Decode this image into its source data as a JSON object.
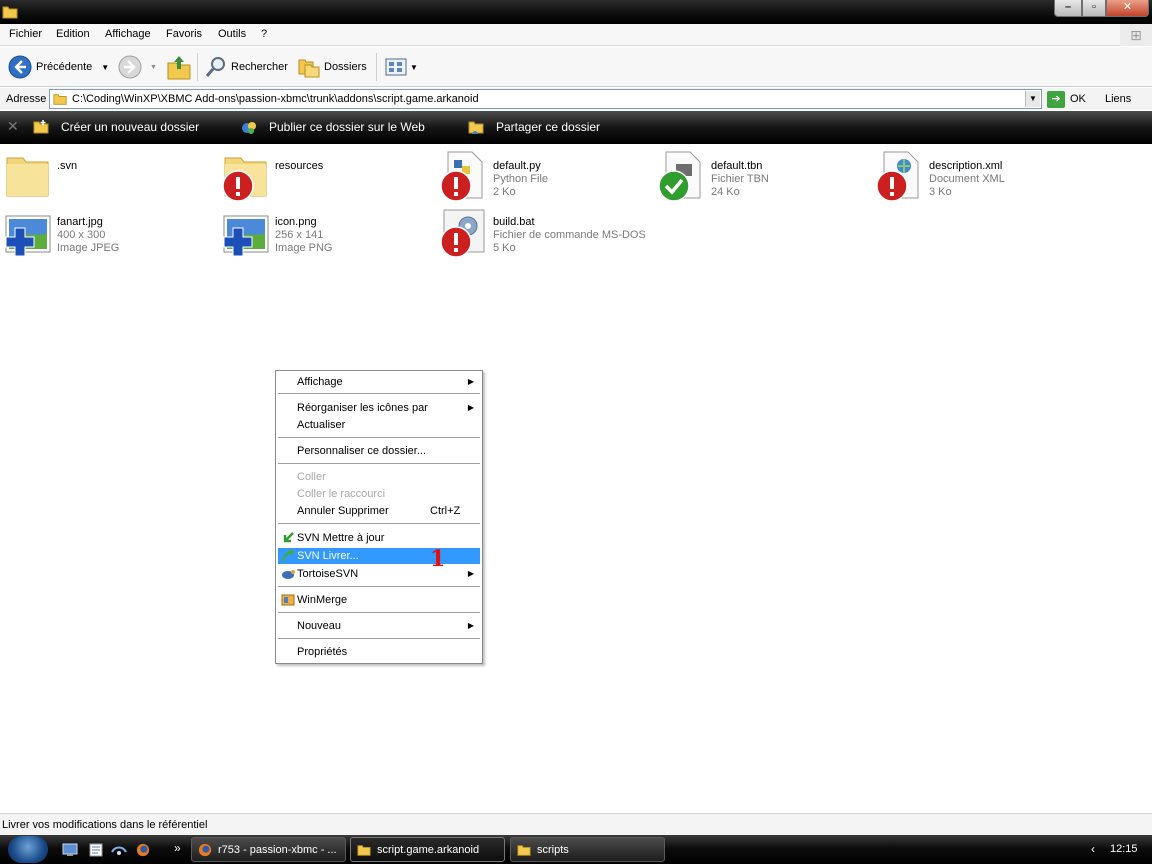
{
  "menubar": {
    "items": [
      "Fichier",
      "Edition",
      "Affichage",
      "Favoris",
      "Outils",
      "?"
    ]
  },
  "toolbar": {
    "back_label": "Précédente",
    "search_label": "Rechercher",
    "folders_label": "Dossiers"
  },
  "address": {
    "label": "Adresse",
    "value": "C:\\Coding\\WinXP\\XBMC Add-ons\\passion-xbmc\\trunk\\addons\\script.game.arkanoid",
    "go_label": "OK",
    "links_label": "Liens"
  },
  "tasks": {
    "new_folder": "Créer un nouveau dossier",
    "publish": "Publier ce dossier sur le Web",
    "share": "Partager ce dossier"
  },
  "files": [
    {
      "name": ".svn",
      "line2": "",
      "line3": "",
      "icon": "folder-icon",
      "overlay": ""
    },
    {
      "name": "resources",
      "line2": "",
      "line3": "",
      "icon": "folder-icon",
      "overlay": "svn-modified-icon"
    },
    {
      "name": "default.py",
      "line2": "Python File",
      "line3": "2 Ko",
      "icon": "python-file-icon",
      "overlay": "svn-modified-icon"
    },
    {
      "name": "default.tbn",
      "line2": "Fichier TBN",
      "line3": "24 Ko",
      "icon": "tbn-file-icon",
      "overlay": "svn-normal-icon"
    },
    {
      "name": "description.xml",
      "line2": "Document XML",
      "line3": "3 Ko",
      "icon": "xml-file-icon",
      "overlay": "svn-modified-icon"
    },
    {
      "name": "fanart.jpg",
      "line2": "400 x 300",
      "line3": "Image JPEG",
      "icon": "image-file-icon",
      "overlay": "svn-added-icon"
    },
    {
      "name": "icon.png",
      "line2": "256 x 141",
      "line3": "Image PNG",
      "icon": "image-file-icon",
      "overlay": "svn-added-icon"
    },
    {
      "name": "build.bat",
      "line2": "Fichier de commande MS-DOS",
      "line3": "5 Ko",
      "icon": "batch-file-icon",
      "overlay": "svn-modified-icon"
    }
  ],
  "context_menu": {
    "affichage": "Affichage",
    "reorganiser": "Réorganiser les icônes par",
    "actualiser": "Actualiser",
    "personnaliser": "Personnaliser ce dossier...",
    "coller": "Coller",
    "coller_raccourci": "Coller le raccourci",
    "annuler": "Annuler Supprimer",
    "annuler_shortcut": "Ctrl+Z",
    "svn_update": "SVN Mettre à jour",
    "svn_commit": "SVN Livrer...",
    "tortoise": "TortoiseSVN",
    "winmerge": "WinMerge",
    "nouveau": "Nouveau",
    "proprietes": "Propriétés"
  },
  "annotation_marker": "1",
  "status": {
    "text": "Livrer vos modifications dans le référentiel"
  },
  "taskbar": {
    "buttons": [
      "r753 - passion-xbmc - ...",
      "script.game.arkanoid",
      "scripts"
    ],
    "overflow": "»",
    "clock": "12:15"
  },
  "colors": {
    "selection": "#3399ff",
    "svn_modified": "#cc1f1f",
    "svn_normal": "#2f9e2f",
    "svn_added": "#1d4fb8"
  }
}
